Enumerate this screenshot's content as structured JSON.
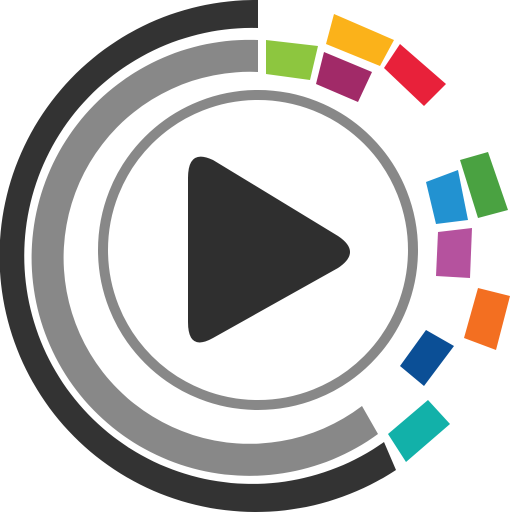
{
  "logo": {
    "icon": "play-icon",
    "colors": {
      "outer_ring": "#333333",
      "middle_ring": "#888888",
      "inner_ring": "#888888",
      "play": "#2f2f2f",
      "background": "#ffffff"
    },
    "segments": [
      {
        "name": "segment-lime",
        "color": "#8dc63f"
      },
      {
        "name": "segment-amber",
        "color": "#fbb21a"
      },
      {
        "name": "segment-purple",
        "color": "#a12a68"
      },
      {
        "name": "segment-red",
        "color": "#e8213a"
      },
      {
        "name": "segment-green",
        "color": "#4aa241"
      },
      {
        "name": "segment-blue",
        "color": "#2292d1"
      },
      {
        "name": "segment-magenta",
        "color": "#b5529e"
      },
      {
        "name": "segment-orange",
        "color": "#f36f21"
      },
      {
        "name": "segment-navy",
        "color": "#0b4f96"
      },
      {
        "name": "segment-teal",
        "color": "#12b1a9"
      }
    ]
  }
}
